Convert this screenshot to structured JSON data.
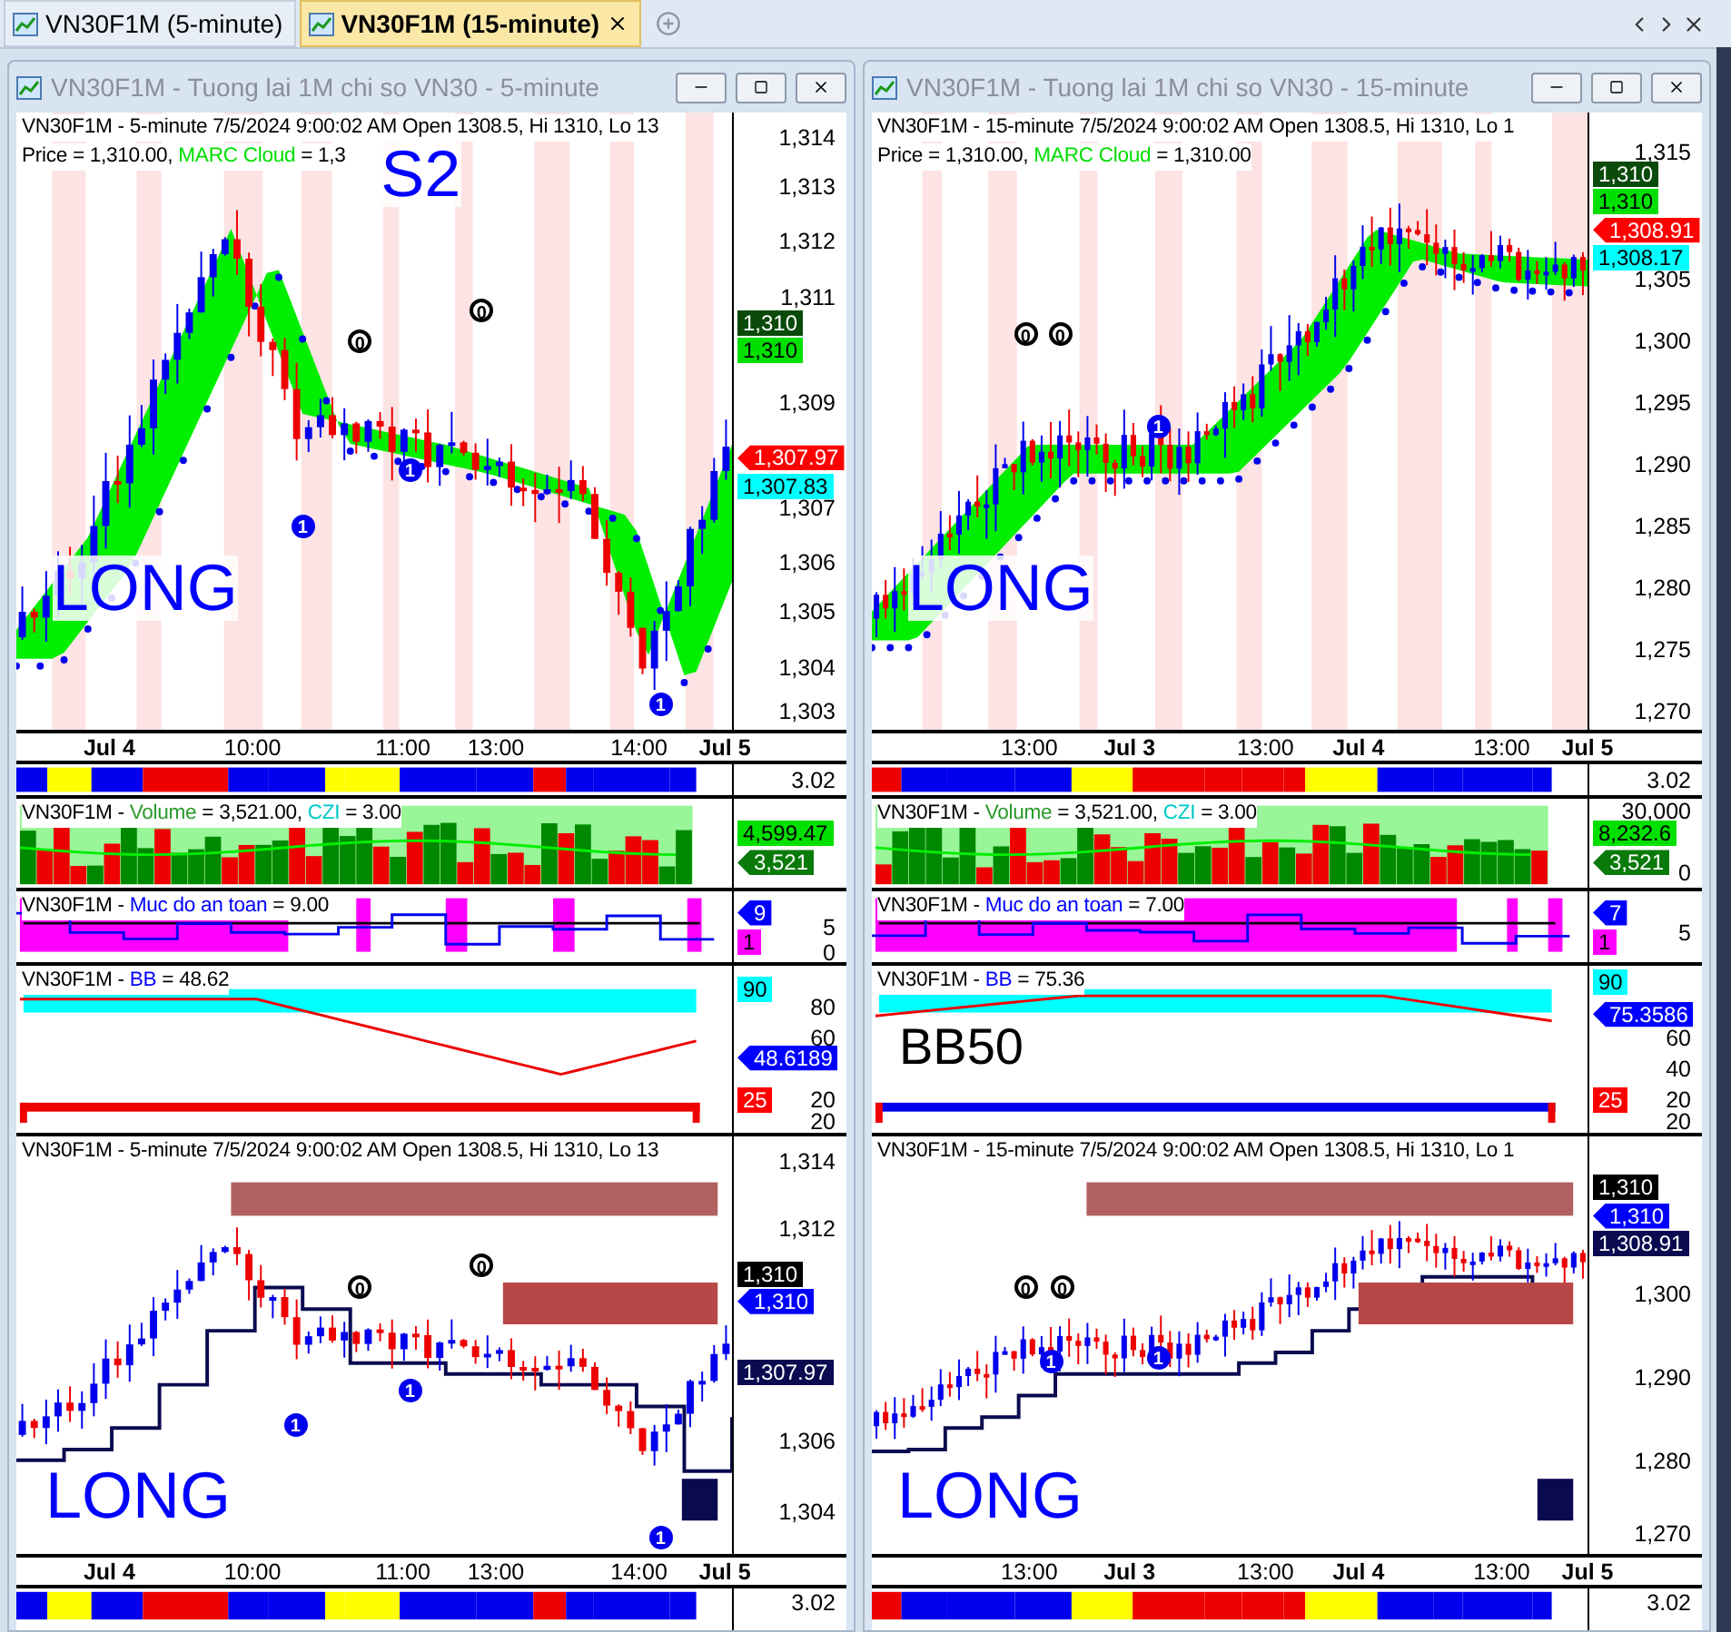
{
  "tabs": [
    {
      "label": "VN30F1M (5-minute)",
      "selected": false
    },
    {
      "label": "VN30F1M (15-minute)",
      "selected": true
    }
  ],
  "windows": [
    {
      "title": "VN30F1M - Tuong lai 1M chi so VN30 - 5-minute",
      "panes": [
        {
          "kind": "price",
          "header": [
            [
              {
                "text": "VN30F1M - 5-minute 7/5/2024 9:00:02 AM Open 1308.5, Hi 1310, Lo 13",
                "kind": "plain"
              }
            ],
            [
              {
                "text": "Price = 1,310.00, ",
                "kind": "plain"
              },
              {
                "text": "MARC Cloud",
                "kind": "lime"
              },
              {
                "text": " = 1,3",
                "kind": "plain"
              }
            ]
          ],
          "axis": [
            "1,314",
            "1,313",
            "1,312",
            "1,311",
            "1,309",
            "1,307",
            "1,306",
            "1,305",
            "1,304",
            "1,303"
          ],
          "badges": [
            {
              "text": "1,310",
              "color": "#0a4a0a",
              "pointer": false
            },
            {
              "text": "1,310",
              "color": "#00e000",
              "pointer": false
            },
            {
              "text": "1,307.97",
              "color": "#ff0000",
              "pointer": true
            },
            {
              "text": "1,307.83",
              "color": "#00ffff",
              "pointer": false
            }
          ],
          "markers": [
            {
              "text": "0",
              "kind": "black"
            },
            {
              "text": "0",
              "kind": "black"
            },
            {
              "text": "1",
              "kind": "blue"
            },
            {
              "text": "1",
              "kind": "blue"
            },
            {
              "text": "1",
              "kind": "blue"
            }
          ],
          "labels": [
            {
              "text": "S2",
              "kind": "signal"
            },
            {
              "text": "LONG",
              "kind": "signal"
            }
          ]
        },
        {
          "kind": "time",
          "labels": [
            {
              "text": "Jul 4",
              "bold": true
            },
            {
              "text": "10:00",
              "bold": false
            },
            {
              "text": "11:00",
              "bold": false
            },
            {
              "text": "13:00",
              "bold": false
            },
            {
              "text": "14:00",
              "bold": false
            },
            {
              "text": "Jul 5",
              "bold": true
            }
          ]
        },
        {
          "kind": "ribbon",
          "axis": [
            "3.02"
          ]
        },
        {
          "kind": "volume",
          "header": [
            [
              {
                "text": "VN30F1M - ",
                "kind": "plain"
              },
              {
                "text": "Volume",
                "kind": "green"
              },
              {
                "text": " = 3,521.00, ",
                "kind": "plain"
              },
              {
                "text": "CZI",
                "kind": "cyan"
              },
              {
                "text": " = 3.00",
                "kind": "plain"
              }
            ]
          ],
          "badges": [
            {
              "text": "4,599.47",
              "color": "#00e000",
              "pointer": false
            },
            {
              "text": "3,521",
              "color": "#0a7a0a",
              "pointer": true
            }
          ]
        },
        {
          "kind": "safety",
          "header": [
            [
              {
                "text": "VN30F1M - ",
                "kind": "plain"
              },
              {
                "text": "Muc do an toan",
                "kind": "blue"
              },
              {
                "text": " = 9.00",
                "kind": "plain"
              }
            ]
          ],
          "axis": [
            "5",
            "0"
          ],
          "badges": [
            {
              "text": "9",
              "color": "#0000ff",
              "pointer": true
            },
            {
              "text": "1",
              "color": "#ff00ff",
              "pointer": false
            }
          ]
        },
        {
          "kind": "bb",
          "header": [
            [
              {
                "text": "VN30F1M - ",
                "kind": "plain"
              },
              {
                "text": "BB",
                "kind": "blue"
              },
              {
                "text": " = 48.62",
                "kind": "plain"
              }
            ]
          ],
          "axis": [
            "80",
            "60",
            "20",
            "20"
          ],
          "badges": [
            {
              "text": "90",
              "color": "#00ffff",
              "pointer": false
            },
            {
              "text": "48.6189",
              "color": "#0000ff",
              "pointer": true
            },
            {
              "text": "25",
              "color": "#ff0000",
              "pointer": false
            }
          ]
        },
        {
          "kind": "zones",
          "header": [
            [
              {
                "text": "VN30F1M - 5-minute 7/5/2024 9:00:02 AM Open 1308.5, Hi 1310, Lo 13",
                "kind": "plain"
              }
            ]
          ],
          "axis": [
            "1,314",
            "1,312",
            "1,306",
            "1,304"
          ],
          "badges": [
            {
              "text": "1,310",
              "color": "#000000",
              "pointer": false
            },
            {
              "text": "1,310",
              "color": "#0000ff",
              "pointer": true
            },
            {
              "text": "1,307.97",
              "color": "#0a0a50",
              "pointer": false
            }
          ],
          "markers": [
            {
              "text": "0",
              "kind": "black"
            },
            {
              "text": "0",
              "kind": "black"
            },
            {
              "text": "1",
              "kind": "blue"
            },
            {
              "text": "1",
              "kind": "blue"
            },
            {
              "text": "1",
              "kind": "blue"
            }
          ],
          "labels": [
            {
              "text": "LONG",
              "kind": "signal"
            }
          ]
        },
        {
          "kind": "time",
          "labels": [
            {
              "text": "Jul 4",
              "bold": true
            },
            {
              "text": "10:00",
              "bold": false
            },
            {
              "text": "11:00",
              "bold": false
            },
            {
              "text": "13:00",
              "bold": false
            },
            {
              "text": "14:00",
              "bold": false
            },
            {
              "text": "Jul 5",
              "bold": true
            }
          ]
        },
        {
          "kind": "ribbon",
          "axis": [
            "3.02"
          ]
        }
      ]
    },
    {
      "title": "VN30F1M - Tuong lai 1M chi so VN30 - 15-minute",
      "panes": [
        {
          "kind": "price",
          "header": [
            [
              {
                "text": "VN30F1M - 15-minute 7/5/2024 9:00:02 AM Open 1308.5, Hi 1310, Lo 1",
                "kind": "plain"
              }
            ],
            [
              {
                "text": "Price = 1,310.00, ",
                "kind": "plain"
              },
              {
                "text": "MARC Cloud",
                "kind": "lime"
              },
              {
                "text": " = 1,310.00",
                "kind": "plain"
              }
            ]
          ],
          "axis": [
            "1,315",
            "1,305",
            "1,300",
            "1,295",
            "1,290",
            "1,285",
            "1,280",
            "1,275",
            "1,270"
          ],
          "badges": [
            {
              "text": "1,310",
              "color": "#0a4a0a",
              "pointer": false
            },
            {
              "text": "1,310",
              "color": "#00e000",
              "pointer": false
            },
            {
              "text": "1,308.91",
              "color": "#ff0000",
              "pointer": true
            },
            {
              "text": "1,308.17",
              "color": "#00ffff",
              "pointer": false
            }
          ],
          "markers": [
            {
              "text": "0",
              "kind": "black"
            },
            {
              "text": "0",
              "kind": "black"
            },
            {
              "text": "1",
              "kind": "blue"
            }
          ],
          "labels": [
            {
              "text": "LONG",
              "kind": "signal"
            }
          ]
        },
        {
          "kind": "time",
          "labels": [
            {
              "text": "13:00",
              "bold": false
            },
            {
              "text": "Jul 3",
              "bold": true
            },
            {
              "text": "13:00",
              "bold": false
            },
            {
              "text": "Jul 4",
              "bold": true
            },
            {
              "text": "13:00",
              "bold": false
            },
            {
              "text": "Jul 5",
              "bold": true
            }
          ]
        },
        {
          "kind": "ribbon",
          "axis": [
            "3.02"
          ]
        },
        {
          "kind": "volume",
          "header": [
            [
              {
                "text": "VN30F1M - ",
                "kind": "plain"
              },
              {
                "text": "Volume",
                "kind": "green"
              },
              {
                "text": " = 3,521.00, ",
                "kind": "plain"
              },
              {
                "text": "CZI",
                "kind": "cyan"
              },
              {
                "text": " = 3.00",
                "kind": "plain"
              }
            ]
          ],
          "axis": [
            "30,000",
            "0"
          ],
          "badges": [
            {
              "text": "8,232.6",
              "color": "#00e000",
              "pointer": false
            },
            {
              "text": "3,521",
              "color": "#0a7a0a",
              "pointer": true
            }
          ]
        },
        {
          "kind": "safety",
          "header": [
            [
              {
                "text": "VN30F1M - ",
                "kind": "plain"
              },
              {
                "text": "Muc do an toan",
                "kind": "blue"
              },
              {
                "text": " = 7.00",
                "kind": "plain"
              }
            ]
          ],
          "axis": [
            "5"
          ],
          "badges": [
            {
              "text": "7",
              "color": "#0000ff",
              "pointer": true
            },
            {
              "text": "1",
              "color": "#ff00ff",
              "pointer": false
            }
          ]
        },
        {
          "kind": "bb",
          "header": [
            [
              {
                "text": "VN30F1M - ",
                "kind": "plain"
              },
              {
                "text": "BB",
                "kind": "blue"
              },
              {
                "text": " = 75.36",
                "kind": "plain"
              }
            ]
          ],
          "axis": [
            "60",
            "40",
            "20",
            "20"
          ],
          "badges": [
            {
              "text": "90",
              "color": "#00ffff",
              "pointer": false
            },
            {
              "text": "75.3586",
              "color": "#0000ff",
              "pointer": true
            },
            {
              "text": "25",
              "color": "#ff0000",
              "pointer": false
            }
          ],
          "labels": [
            {
              "text": "BB50",
              "kind": "note"
            }
          ]
        },
        {
          "kind": "zones",
          "header": [
            [
              {
                "text": "VN30F1M - 15-minute 7/5/2024 9:00:02 AM Open 1308.5, Hi 1310, Lo 1",
                "kind": "plain"
              }
            ]
          ],
          "axis": [
            "1,300",
            "1,290",
            "1,280",
            "1,270"
          ],
          "badges": [
            {
              "text": "1,310",
              "color": "#000000",
              "pointer": false
            },
            {
              "text": "1,310",
              "color": "#0000ff",
              "pointer": true
            },
            {
              "text": "1,308.91",
              "color": "#0a0a50",
              "pointer": false
            }
          ],
          "markers": [
            {
              "text": "0",
              "kind": "black"
            },
            {
              "text": "0",
              "kind": "black"
            },
            {
              "text": "1",
              "kind": "blue"
            },
            {
              "text": "1",
              "kind": "blue"
            }
          ],
          "labels": [
            {
              "text": "LONG",
              "kind": "signal"
            }
          ]
        },
        {
          "kind": "time",
          "labels": [
            {
              "text": "13:00",
              "bold": false
            },
            {
              "text": "Jul 3",
              "bold": true
            },
            {
              "text": "13:00",
              "bold": false
            },
            {
              "text": "Jul 4",
              "bold": true
            },
            {
              "text": "13:00",
              "bold": false
            },
            {
              "text": "Jul 5",
              "bold": true
            }
          ]
        },
        {
          "kind": "ribbon",
          "axis": [
            "3.02"
          ]
        }
      ]
    }
  ]
}
